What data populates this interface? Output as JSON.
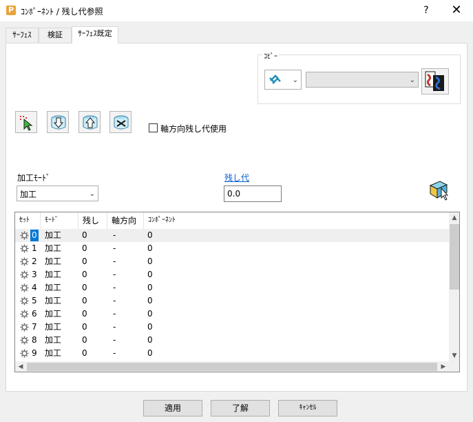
{
  "window": {
    "title": "ｺﾝﾎﾟｰﾈﾝﾄ / 残し代参照",
    "app_icon_letter": "P",
    "help_label": "?",
    "close_label": "✕"
  },
  "tabs": [
    {
      "label": "ｻｰﾌｪｽ"
    },
    {
      "label": "検証"
    },
    {
      "label": "ｻｰﾌｪｽ既定"
    }
  ],
  "copy_group": {
    "label": "ｺﾋﾟｰ",
    "mode_icon": "surface-icon",
    "target_value": ""
  },
  "toolbar": {
    "icons": [
      "select-arrow-icon",
      "down-arrow-cylinder-icon",
      "up-arrow-cylinder-icon",
      "swap-cylinder-icon"
    ]
  },
  "axial_checkbox": {
    "label": "軸方向残し代使用",
    "checked": false
  },
  "machining_mode": {
    "label": "加工ﾓｰﾄﾞ",
    "value": "加工"
  },
  "allowance": {
    "label": "残し代",
    "value": "0.0"
  },
  "table": {
    "columns": [
      "ｾｯﾄ",
      "ﾓｰﾄﾞ",
      "残し代",
      "軸方向",
      "ｺﾝﾎﾟｰﾈﾝﾄ"
    ],
    "rows": [
      {
        "set": "0",
        "mode": "加工",
        "allowance": "0",
        "axial": "-",
        "component": "0"
      },
      {
        "set": "1",
        "mode": "加工",
        "allowance": "0",
        "axial": "-",
        "component": "0"
      },
      {
        "set": "2",
        "mode": "加工",
        "allowance": "0",
        "axial": "-",
        "component": "0"
      },
      {
        "set": "3",
        "mode": "加工",
        "allowance": "0",
        "axial": "-",
        "component": "0"
      },
      {
        "set": "4",
        "mode": "加工",
        "allowance": "0",
        "axial": "-",
        "component": "0"
      },
      {
        "set": "5",
        "mode": "加工",
        "allowance": "0",
        "axial": "-",
        "component": "0"
      },
      {
        "set": "6",
        "mode": "加工",
        "allowance": "0",
        "axial": "-",
        "component": "0"
      },
      {
        "set": "7",
        "mode": "加工",
        "allowance": "0",
        "axial": "-",
        "component": "0"
      },
      {
        "set": "8",
        "mode": "加工",
        "allowance": "0",
        "axial": "-",
        "component": "0"
      },
      {
        "set": "9",
        "mode": "加工",
        "allowance": "0",
        "axial": "-",
        "component": "0"
      }
    ]
  },
  "buttons": {
    "apply": "適用",
    "ok": "了解",
    "cancel": "ｷｬﾝｾﾙ"
  },
  "colors": {
    "selection": "#0078d7",
    "link": "#0b5ec9"
  }
}
